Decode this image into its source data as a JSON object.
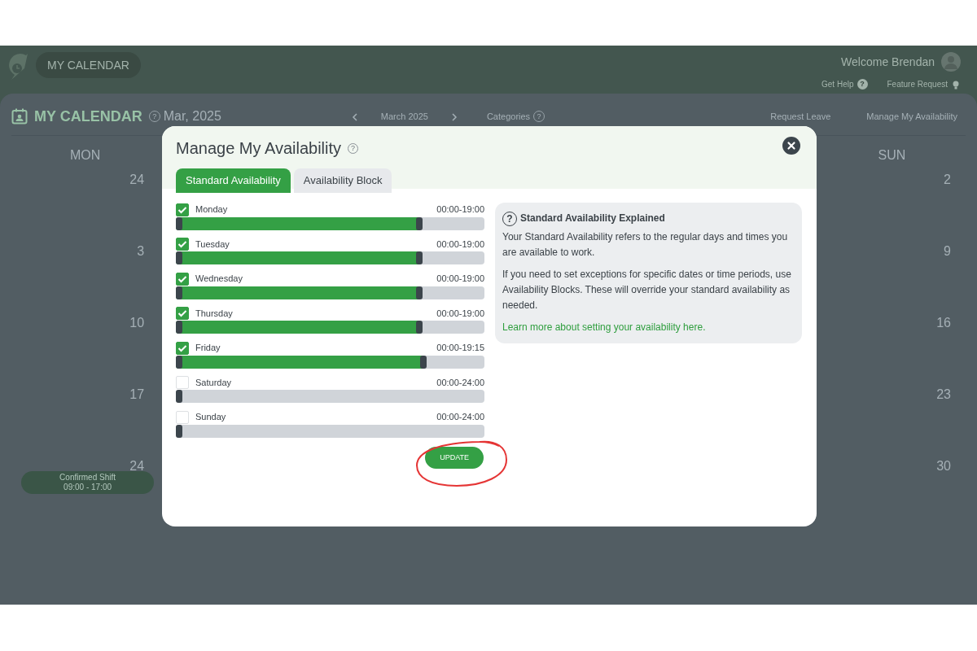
{
  "header": {
    "nav_pill": "MY CALENDAR",
    "welcome": "Welcome Brendan",
    "links": [
      {
        "label": "Get Help",
        "kind": "help",
        "icon": "?"
      },
      {
        "label": "Feature Request",
        "kind": "idea"
      }
    ]
  },
  "calendar": {
    "title": "MY CALENDAR",
    "title_help": "?",
    "period": "Mar, 2025",
    "month": "March 2025",
    "categories": "Categories",
    "categories_help": "?",
    "actions": [
      "Request Leave",
      "Manage My Availability"
    ],
    "columns": [
      {
        "label": "MON",
        "dates": [
          {
            "date": "24"
          },
          {
            "date": "3"
          },
          {
            "date": "10"
          },
          {
            "date": "17"
          },
          {
            "date": "24",
            "shift": {
              "title": "Confirmed Shift",
              "time": "09:00 - 17:00"
            }
          }
        ]
      },
      {
        "label": "SUN",
        "dates": [
          {
            "date": "2"
          },
          {
            "date": "9"
          },
          {
            "date": "16"
          },
          {
            "date": "23"
          },
          {
            "date": "30"
          }
        ]
      }
    ]
  },
  "modal": {
    "title": "Manage My Availability",
    "title_help": "?",
    "tabs": [
      {
        "label": "Standard Availability",
        "selected": true
      },
      {
        "label": "Availability Block",
        "selected": false
      }
    ],
    "days": [
      {
        "name": "Monday",
        "checked": true,
        "hours": "00:00-19:00",
        "level": 0.79
      },
      {
        "name": "Tuesday",
        "checked": true,
        "hours": "00:00-19:00",
        "level": 0.79
      },
      {
        "name": "Wednesday",
        "checked": true,
        "hours": "00:00-19:00",
        "level": 0.79
      },
      {
        "name": "Thursday",
        "checked": true,
        "hours": "00:00-19:00",
        "level": 0.79
      },
      {
        "name": "Friday",
        "checked": true,
        "hours": "00:00-19:15",
        "level": 0.802
      },
      {
        "name": "Saturday",
        "checked": false,
        "hours": "00:00-24:00",
        "level": 0
      },
      {
        "name": "Sunday",
        "checked": false,
        "hours": "00:00-24:00",
        "level": 0
      }
    ],
    "info": {
      "icon": "?",
      "title": "Standard Availability Explained",
      "paragraphs": [
        "Your Standard Availability refers to the regular days and times you are available to work.",
        "If you need to set exceptions for specific dates or time periods, use Availability Blocks. These will override your standard availability as needed."
      ],
      "link": "Learn more about setting your availability here."
    },
    "update_button": "UPDATE",
    "update_highlighted": true
  }
}
